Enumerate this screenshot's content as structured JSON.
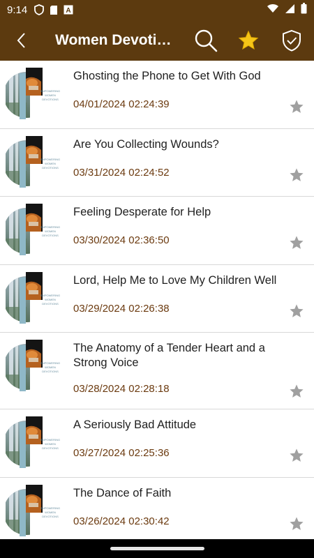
{
  "status": {
    "time": "9:14"
  },
  "header": {
    "title": "Women Devotions",
    "back_icon": "back-chevron-icon",
    "search_icon": "search-icon",
    "favorites_icon": "star-icon",
    "shield_icon": "shield-check-icon",
    "background": "#5c3a0f"
  },
  "thumbnail_caption": "EMPOWERING WOMEN DEVOTIONS",
  "items": [
    {
      "title": "Ghosting the Phone to Get With God",
      "date": "04/01/2024 02:24:39"
    },
    {
      "title": "Are You Collecting Wounds?",
      "date": "03/31/2024 02:24:52"
    },
    {
      "title": "Feeling Desperate for Help",
      "date": "03/30/2024 02:36:50"
    },
    {
      "title": "Lord, Help Me to Love My Children Well",
      "date": "03/29/2024 02:26:38"
    },
    {
      "title": "The Anatomy of a Tender Heart and a Strong Voice",
      "date": "03/28/2024 02:28:18"
    },
    {
      "title": "A Seriously Bad Attitude",
      "date": "03/27/2024 02:25:36"
    },
    {
      "title": "The Dance of Faith",
      "date": "03/26/2024 02:30:42"
    }
  ],
  "colors": {
    "date_text": "#6b3a0f",
    "star_inactive": "#a0a0a0",
    "star_active": "#f5c518"
  }
}
